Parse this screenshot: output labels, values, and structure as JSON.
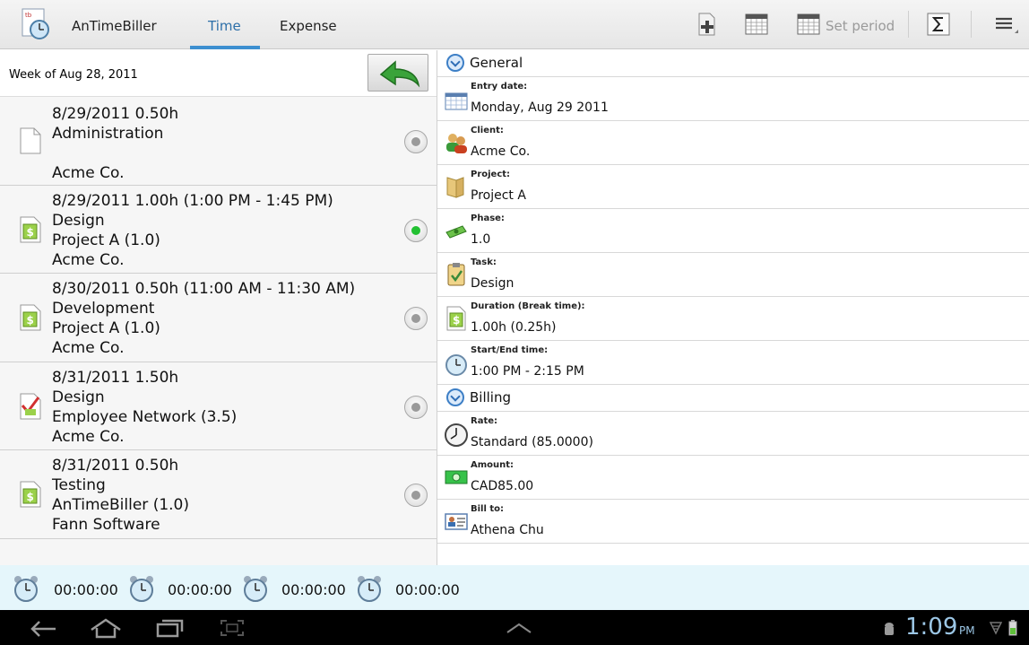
{
  "app": {
    "title": "AnTimeBiller"
  },
  "tabs": [
    {
      "label": "Time",
      "active": true
    },
    {
      "label": "Expense",
      "active": false
    }
  ],
  "toolbar": {
    "set_period_label": "Set period"
  },
  "left": {
    "week_label": "Week of Aug 28, 2011",
    "entries": [
      {
        "lines": [
          "8/29/2011 0.50h",
          "Administration",
          "",
          "Acme Co."
        ],
        "icon": "document-icon",
        "selected": false
      },
      {
        "lines": [
          "8/29/2011 1.00h (1:00 PM - 1:45 PM)",
          "Design",
          "Project A (1.0)",
          "Acme Co."
        ],
        "icon": "dollar-document-icon",
        "selected": true
      },
      {
        "lines": [
          "8/30/2011 0.50h (11:00 AM - 11:30 AM)",
          "Development",
          "Project A (1.0)",
          "Acme Co."
        ],
        "icon": "dollar-document-icon",
        "selected": false
      },
      {
        "lines": [
          "8/31/2011 1.50h",
          "Design",
          "Employee Network (3.5)",
          "Acme Co."
        ],
        "icon": "checked-document-icon",
        "selected": false
      },
      {
        "lines": [
          "8/31/2011 0.50h",
          "Testing",
          "AnTimeBiller (1.0)",
          "Fann Software"
        ],
        "icon": "dollar-document-icon",
        "selected": false
      }
    ]
  },
  "detail": {
    "general_title": "General",
    "billing_title": "Billing",
    "fields": {
      "entry_date": {
        "label": "Entry date:",
        "value": "Monday, Aug 29 2011"
      },
      "client": {
        "label": "Client:",
        "value": "Acme Co."
      },
      "project": {
        "label": "Project:",
        "value": "Project A"
      },
      "phase": {
        "label": "Phase:",
        "value": "1.0"
      },
      "task": {
        "label": "Task:",
        "value": "Design"
      },
      "duration": {
        "label": "Duration (Break time):",
        "value": "1.00h (0.25h)"
      },
      "start_end": {
        "label": "Start/End time:",
        "value": "1:00 PM - 2:15 PM"
      },
      "rate": {
        "label": "Rate:",
        "value": "Standard (85.0000)"
      },
      "amount": {
        "label": "Amount:",
        "value": "CAD85.00"
      },
      "bill_to": {
        "label": "Bill to:",
        "value": "Athena Chu"
      }
    }
  },
  "timers": [
    "00:00:00",
    "00:00:00",
    "00:00:00",
    "00:00:00"
  ],
  "system": {
    "time": "1:09",
    "ampm": "PM"
  },
  "colors": {
    "accent": "#3d8fd0",
    "timer_bar": "#e5f6fb",
    "selected_radio": "#22c032"
  }
}
